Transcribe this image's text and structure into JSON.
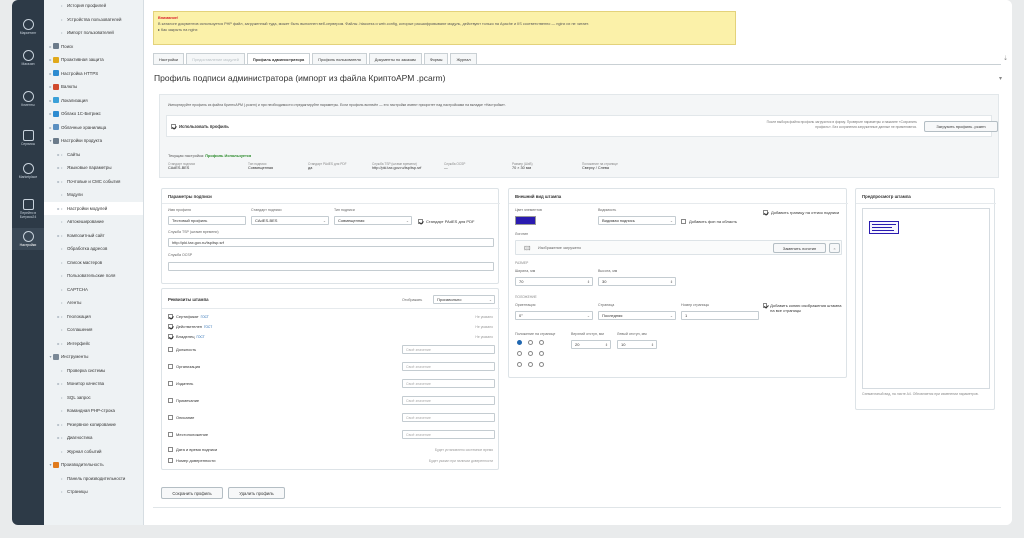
{
  "leftbar": {
    "items": [
      {
        "label": "Маркетинг",
        "icon": "target-icon"
      },
      {
        "label": "Магазин",
        "icon": "cart-icon"
      },
      {
        "label": "Клиенты",
        "icon": "clients-icon"
      },
      {
        "label": "Сервисы",
        "icon": "layers-icon"
      },
      {
        "label": "Marketplace",
        "icon": "cloud-icon"
      },
      {
        "label": "Перейти в Битрикс24",
        "icon": "bitrix-icon"
      },
      {
        "label": "Настройки",
        "icon": "gear-icon"
      }
    ]
  },
  "menu": {
    "items": [
      {
        "label": "История профилей",
        "level": 2,
        "arrow": "",
        "icon": ""
      },
      {
        "label": "Устройства пользователей",
        "level": 2,
        "arrow": "",
        "icon": ""
      },
      {
        "label": "Импорт пользователей",
        "level": 2,
        "arrow": "",
        "icon": ""
      },
      {
        "label": "Поиск",
        "level": 1,
        "arrow": "▸",
        "icon": "search-icon"
      },
      {
        "label": "Проактивная защита",
        "level": 1,
        "arrow": "▸",
        "icon": "shield-icon"
      },
      {
        "label": "Настройка HTTPS",
        "level": 1,
        "arrow": "▸",
        "icon": "lock-icon"
      },
      {
        "label": "Валюты",
        "level": 1,
        "arrow": "▸",
        "icon": "currency-icon"
      },
      {
        "label": "Локализация",
        "level": 1,
        "arrow": "▸",
        "icon": "globe-icon"
      },
      {
        "label": "Облако 1С-Битрикс",
        "level": 1,
        "arrow": "▸",
        "icon": "cloud-icon"
      },
      {
        "label": "Облачные хранилища",
        "level": 1,
        "arrow": "▸",
        "icon": "storage-icon"
      },
      {
        "label": "Настройки продукта",
        "level": 1,
        "arrow": "▾",
        "icon": "settings-icon"
      },
      {
        "label": "Сайты",
        "level": 2,
        "arrow": "▸",
        "icon": ""
      },
      {
        "label": "Языковые параметры",
        "level": 2,
        "arrow": "▸",
        "icon": ""
      },
      {
        "label": "Почтовые и СМС события",
        "level": 2,
        "arrow": "▸",
        "icon": ""
      },
      {
        "label": "Модули",
        "level": 2,
        "arrow": "",
        "icon": ""
      },
      {
        "label": "Настройки модулей",
        "level": 2,
        "arrow": "▸",
        "icon": "",
        "selected": true
      },
      {
        "label": "Автокеширование",
        "level": 2,
        "arrow": "",
        "icon": ""
      },
      {
        "label": "Композитный сайт",
        "level": 2,
        "arrow": "▸",
        "icon": ""
      },
      {
        "label": "Обработка адресов",
        "level": 2,
        "arrow": "",
        "icon": ""
      },
      {
        "label": "Список мастеров",
        "level": 2,
        "arrow": "",
        "icon": ""
      },
      {
        "label": "Пользовательские поля",
        "level": 2,
        "arrow": "",
        "icon": ""
      },
      {
        "label": "CAPTCHA",
        "level": 2,
        "arrow": "",
        "icon": ""
      },
      {
        "label": "Агенты",
        "level": 2,
        "arrow": "",
        "icon": ""
      },
      {
        "label": "Геолокация",
        "level": 2,
        "arrow": "▸",
        "icon": ""
      },
      {
        "label": "Соглашения",
        "level": 2,
        "arrow": "",
        "icon": ""
      },
      {
        "label": "Интерфейс",
        "level": 2,
        "arrow": "▸",
        "icon": ""
      },
      {
        "label": "Инструменты",
        "level": 1,
        "arrow": "▾",
        "icon": "tools-icon"
      },
      {
        "label": "Проверка системы",
        "level": 2,
        "arrow": "",
        "icon": ""
      },
      {
        "label": "Монитор качества",
        "level": 2,
        "arrow": "▸",
        "icon": ""
      },
      {
        "label": "SQL запрос",
        "level": 2,
        "arrow": "",
        "icon": ""
      },
      {
        "label": "Командная PHP-строка",
        "level": 2,
        "arrow": "",
        "icon": ""
      },
      {
        "label": "Резервное копирование",
        "level": 2,
        "arrow": "▸",
        "icon": ""
      },
      {
        "label": "Диагностика",
        "level": 2,
        "arrow": "▸",
        "icon": ""
      },
      {
        "label": "Журнал событий",
        "level": 2,
        "arrow": "",
        "icon": ""
      },
      {
        "label": "Производительность",
        "level": 1,
        "arrow": "▾",
        "icon": "speed-icon"
      },
      {
        "label": "Панель производительности",
        "level": 2,
        "arrow": "",
        "icon": ""
      },
      {
        "label": "Страницы",
        "level": 2,
        "arrow": "",
        "icon": ""
      }
    ]
  },
  "warning": {
    "title": "Внимание!",
    "text": "В каталоге документов используется PHP файл, загруженный туда, может быть выполнен веб-сервером. Файлы .htaccess и web.config, которые расшифровывают модуль, действуют только на Apache и IIS соответственно — nginx их не читает.",
    "link": "▸ Как закрыть на nginx"
  },
  "tabs": [
    {
      "label": "Настройки",
      "state": "normal"
    },
    {
      "label": "Предоставление модулей",
      "state": "disabled"
    },
    {
      "label": "Профиль администратора",
      "state": "active"
    },
    {
      "label": "Профиль пользователя",
      "state": "normal"
    },
    {
      "label": "Документы по заказам",
      "state": "normal"
    },
    {
      "label": "Формы",
      "state": "normal"
    },
    {
      "label": "Журнал",
      "state": "normal"
    }
  ],
  "page_title": "Профиль подписи администратора (импорт из файла КриптоАРМ .pcarm)",
  "info": {
    "intro": "Импортируйте профиль из файла КриптоАРМ (.pcarm) и при необходимости отредактируйте параметры. Если профиль включён — его настройки имеют приоритет над настройками на вкладке «Настройки».",
    "use_profile_label": "Использовать профиль",
    "use_profile_checked": true,
    "right_note": "После выбора файла профиль загрузится в форму. Проверьте параметры и нажмите «Сохранить профиль». Без сохранения загруженные данные не применяются.",
    "load_button": "Загрузить профиль .pcarm",
    "current_label": "Текущая настройка:",
    "current_value": "Профиль Используется",
    "summary": [
      {
        "label": "Стандарт подписи",
        "value": "CAdES-BES"
      },
      {
        "label": "Тип подписи",
        "value": "Совмещенная"
      },
      {
        "label": "Стандарт PAdES для PDF",
        "value": "да"
      },
      {
        "label": "Служба TSP (штамп времени)",
        "value": "http://pki.tax.gov.ru/tsp/tsp.srf"
      },
      {
        "label": "Служба OCSP",
        "value": "—"
      },
      {
        "label": "Размер (ШхВ)",
        "value": "70 × 30 мм"
      },
      {
        "label": "Положение на странице",
        "value": "Сверху / Слева"
      }
    ]
  },
  "params": {
    "title": "Параметры подписи",
    "name_label": "Имя профиля",
    "name_value": "Тестовый профиль",
    "std_label": "Стандарт подписи",
    "std_value": "CAdES-BES",
    "type_label": "Тип подписи",
    "type_value": "Совмещенная",
    "pades_label": "Стандарт PAdES для PDF",
    "tsp_label": "Служба TSP (штамп времени)",
    "tsp_value": "http://pki.tax.gov.ru/tsp/tsp.srf",
    "ocsp_label": "Служба OCSP",
    "ocsp_value": ""
  },
  "requisites": {
    "title": "Реквизиты штампа",
    "show_label": "Отображать",
    "show_value": "Произвольно",
    "rows": [
      {
        "label": "Сертификат",
        "checked": true,
        "gost": "ГОСТ",
        "kind": "note",
        "note": "Не указано"
      },
      {
        "label": "Действителен",
        "checked": true,
        "gost": "ГОСТ",
        "kind": "note",
        "note": "Не указано"
      },
      {
        "label": "Владелец",
        "checked": true,
        "gost": "ГОСТ",
        "kind": "note",
        "note": "Не указано"
      },
      {
        "label": "Должность",
        "checked": false,
        "gost": "",
        "kind": "input",
        "note": "Своё значение"
      },
      {
        "label": "Организация",
        "checked": false,
        "gost": "",
        "kind": "input",
        "note": "Своё значение"
      },
      {
        "label": "Издатель",
        "checked": false,
        "gost": "",
        "kind": "input",
        "note": "Своё значение"
      },
      {
        "label": "Примечание",
        "checked": false,
        "gost": "",
        "kind": "input",
        "note": "Своё значение"
      },
      {
        "label": "Описание",
        "checked": false,
        "gost": "",
        "kind": "input",
        "note": "Своё значение"
      },
      {
        "label": "Местоположение",
        "checked": false,
        "gost": "",
        "kind": "input",
        "note": "Своё значение"
      },
      {
        "label": "Дата и время подписи",
        "checked": false,
        "gost": "",
        "kind": "note",
        "note": "Будет установлено системное время"
      },
      {
        "label": "Номер доверенности",
        "checked": false,
        "gost": "",
        "kind": "note",
        "note": "Будет указан при наличии доверенности"
      }
    ]
  },
  "appearance": {
    "title": "Внешний вид штампа",
    "color_label": "Цвет элементов",
    "color": "#2a1bb0",
    "visibility_label": "Видимость",
    "visibility_value": "Видимая подпись",
    "bg_label": "Добавить фон на область",
    "border_label": "Добавить границу на оттиск подписи",
    "logo_label": "Логотип",
    "logo_text": "Изображение загружено",
    "replace_logo": "Заменить логотип",
    "remove_logo": "×",
    "size_section": "РАЗМЕР",
    "width_label": "Ширина, мм",
    "width_value": "70",
    "height_label": "Высота, мм",
    "height_value": "30",
    "pos_section": "ПОЛОЖЕНИЕ",
    "orient_label": "Ориентация",
    "orient_value": "0°",
    "page_label": "Страница",
    "page_value": "Последняя",
    "pagenum_label": "Номер страницы",
    "pagenum_value": "1",
    "copy_label": "Добавить копию изображения штампа на все страницы",
    "anchor_label": "Положение на странице",
    "top_label": "Верхний отступ, мм",
    "top_value": "20",
    "left_label": "Левый отступ, мм",
    "left_value": "10"
  },
  "preview": {
    "title": "Предпросмотр штампа",
    "caption": "Схематичный вид, на листе А4. Обновляется при изменении параметров."
  },
  "actions": {
    "save": "Сохранить профиль",
    "delete": "Удалить профиль"
  }
}
